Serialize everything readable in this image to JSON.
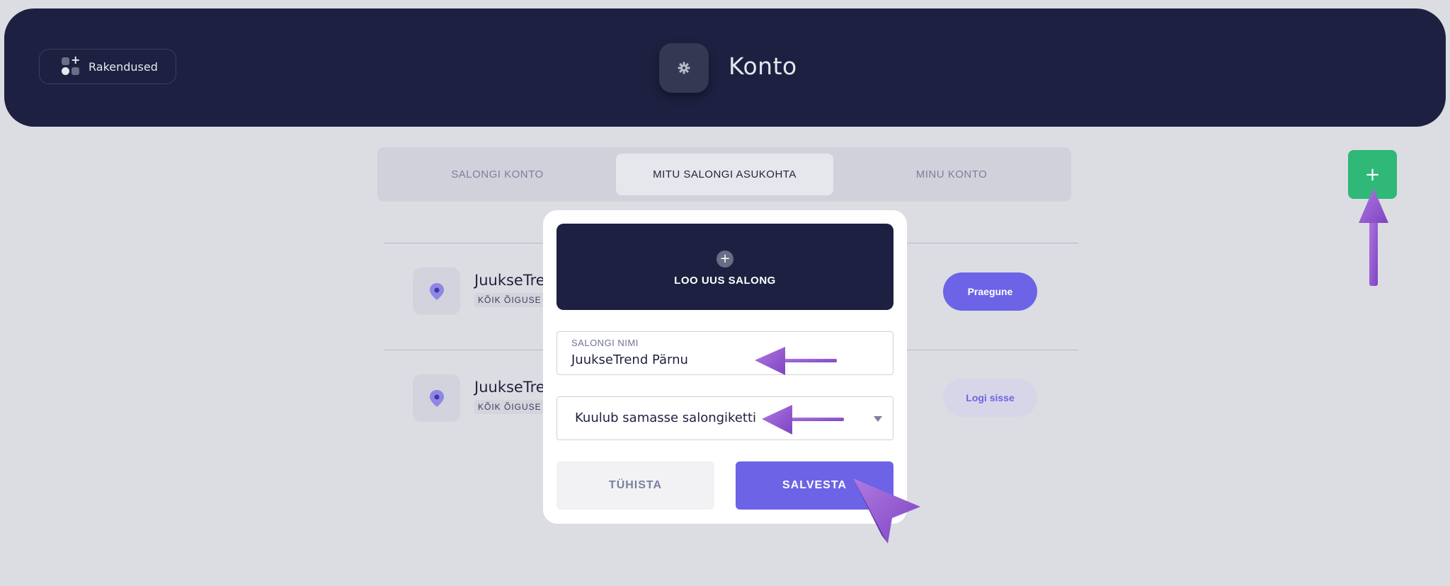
{
  "header": {
    "apps_label": "Rakendused",
    "title": "Konto"
  },
  "tabs": [
    {
      "label": "SALONGI KONTO",
      "active": false
    },
    {
      "label": "MITU SALONGI ASUKOHTA",
      "active": true
    },
    {
      "label": "MINU KONTO",
      "active": false
    }
  ],
  "salons": [
    {
      "name": "JuukseTre",
      "badge": "KÕIK ÕIGUSE",
      "action": "Praegune"
    },
    {
      "name": "JuukseTre",
      "badge": "KÕIK ÕIGUSE",
      "action": "Logi sisse"
    }
  ],
  "modal": {
    "new_salon_label": "LOO UUS SALONG",
    "name_field_label": "SALONGI NIMI",
    "name_field_value": "JuukseTrend Pärnu",
    "group_select_value": "Kuulub samasse salongiketti",
    "cancel_label": "TÜHISTA",
    "save_label": "SALVESTA"
  },
  "colors": {
    "header_bg": "#1d2040",
    "accent": "#6c63e6",
    "add_button": "#2fb877",
    "pointer": "#9b63d4"
  },
  "icons": {
    "apps": "apps-icon",
    "settings": "gear-icon",
    "add": "plus-icon",
    "location": "location-pin-icon",
    "new_salon": "plus-circle-icon",
    "select": "chevron-down-icon"
  }
}
